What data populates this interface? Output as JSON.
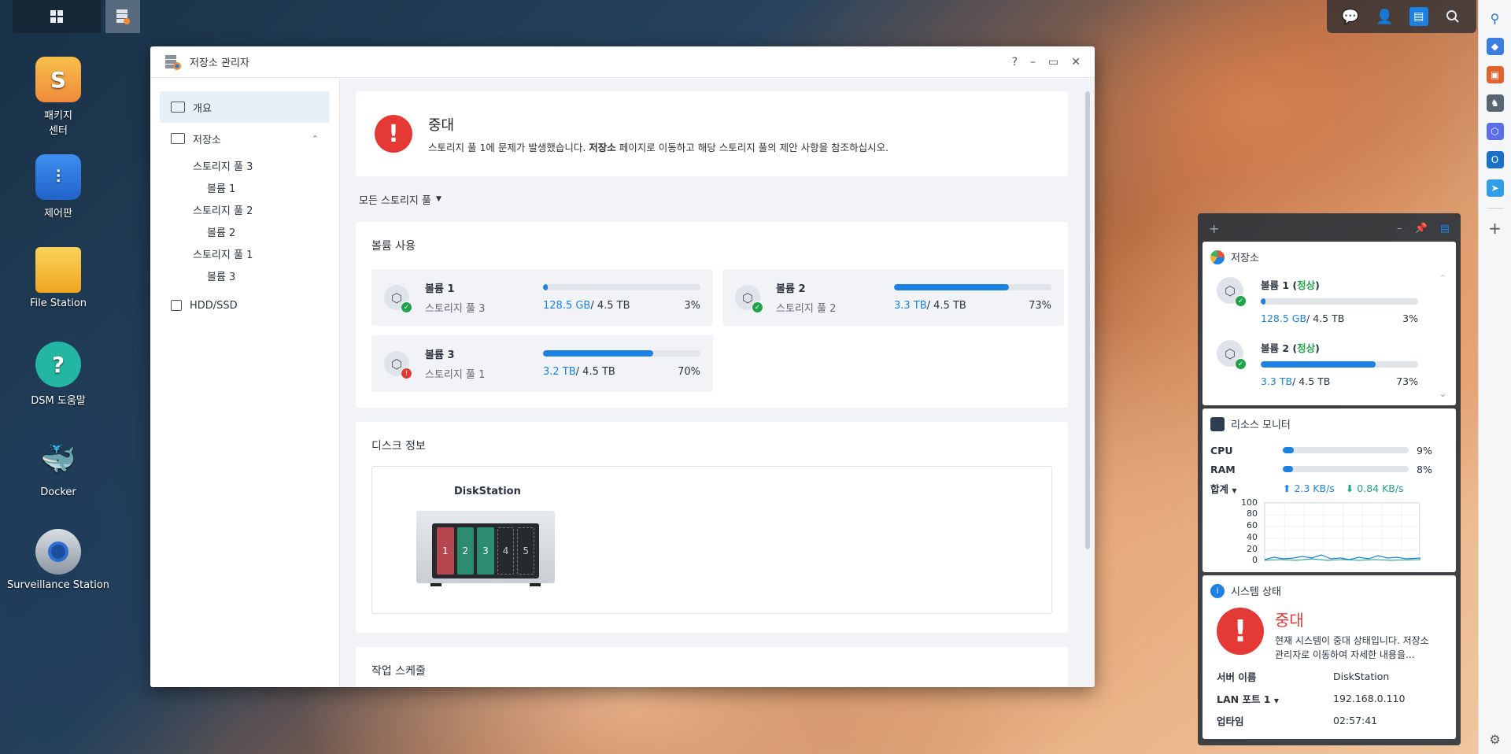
{
  "desktop": {
    "icons": [
      {
        "label": "패키지\n센터"
      },
      {
        "label": "제어판"
      },
      {
        "label": "File Station"
      },
      {
        "label": "DSM 도움말"
      },
      {
        "label": "Docker"
      },
      {
        "label": "Surveillance Station"
      }
    ]
  },
  "window": {
    "title": "저장소 관리자",
    "controls": {
      "help": "?",
      "minimize": "–",
      "maximize": "▭",
      "close": "✕"
    },
    "sidebar": {
      "overview": "개요",
      "storage": "저장소",
      "pools": [
        {
          "pool": "스토리지 풀 3",
          "volume": "볼륨 1"
        },
        {
          "pool": "스토리지 풀 2",
          "volume": "볼륨 2"
        },
        {
          "pool": "스토리지 풀 1",
          "volume": "볼륨 3"
        }
      ],
      "hdd": "HDD/SSD"
    },
    "alert": {
      "title": "중대",
      "desc_prefix": "스토리지 풀 1에 문제가 발생했습니다. ",
      "desc_bold": "저장소",
      "desc_suffix": " 페이지로 이동하고 해당 스토리지 풀의 제안 사항을 참조하십시오."
    },
    "pool_filter": "모든 스토리지 풀",
    "volume_usage": {
      "title": "볼륨 사용",
      "volumes": [
        {
          "name": "볼륨 1",
          "pool": "스토리지 풀 3",
          "used": "128.5 GB",
          "total": " / 4.5 TB",
          "percent": "3%",
          "fill": 3,
          "status": "ok"
        },
        {
          "name": "볼륨 2",
          "pool": "스토리지 풀 2",
          "used": "3.3 TB",
          "total": " / 4.5 TB",
          "percent": "73%",
          "fill": 73,
          "status": "ok"
        },
        {
          "name": "볼륨 3",
          "pool": "스토리지 풀 1",
          "used": "3.2 TB",
          "total": " / 4.5 TB",
          "percent": "70%",
          "fill": 70,
          "status": "error"
        }
      ]
    },
    "disk_info": {
      "title": "디스크 정보",
      "device": "DiskStation",
      "bays": [
        "1",
        "2",
        "3",
        "4",
        "5"
      ]
    },
    "schedule": {
      "title": "작업 스케줄"
    }
  },
  "widgets": {
    "storage": {
      "title": "저장소",
      "volumes": [
        {
          "name": "볼륨 1",
          "status": "정상",
          "used": "128.5 GB",
          "total": " / 4.5 TB",
          "percent": "3%",
          "fill": 3
        },
        {
          "name": "볼륨 2",
          "status": "정상",
          "used": "3.3 TB",
          "total": " / 4.5 TB",
          "percent": "73%",
          "fill": 73
        }
      ]
    },
    "resource": {
      "title": "리소스 모니터",
      "cpu_label": "CPU",
      "cpu_value": "9%",
      "cpu_fill": 9,
      "ram_label": "RAM",
      "ram_value": "8%",
      "ram_fill": 8,
      "net_label": "합계",
      "upload": "2.3 KB/s",
      "download": "0.84 KB/s",
      "y_ticks": [
        "100",
        "80",
        "60",
        "40",
        "20",
        "0"
      ]
    },
    "system": {
      "title": "시스템 상태",
      "status": "중대",
      "desc": "현재 시스템이 중대 상태입니다. 저장소 관리자로 이동하여 자세한 내용을...",
      "server_label": "서버 이름",
      "server_value": "DiskStation",
      "lan_label": "LAN 포트 1",
      "lan_value": "192.168.0.110",
      "uptime_label": "업타임",
      "uptime_value": "02:57:41"
    }
  },
  "colors": {
    "accent": "#1b82e4",
    "critical": "#e53935",
    "ok": "#1fa34a"
  }
}
